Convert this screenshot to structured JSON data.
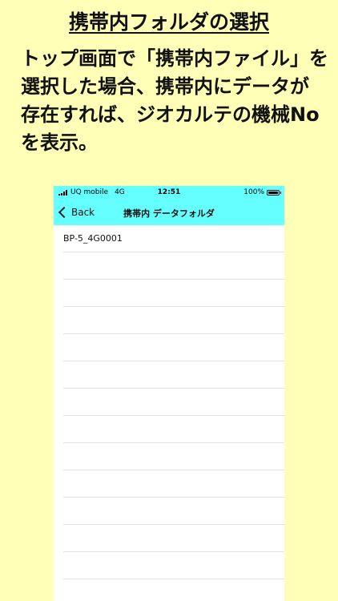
{
  "page": {
    "title": "携帯内フォルダの選択",
    "description_lines": [
      "トップ画面で「携帯内ファイル」を",
      "選択した場合、携帯内にデータが",
      "存在すれば、ジオカルテの機械No",
      "を表示。"
    ]
  },
  "phone": {
    "status": {
      "carrier": "UQ mobile",
      "network": "4G",
      "time": "12:51",
      "battery": "100%"
    },
    "nav": {
      "back_label": "Back",
      "title": "携帯内 データフォルダ"
    },
    "list": {
      "items": [
        "BP-5_4G0001",
        "",
        "",
        "",
        "",
        "",
        "",
        "",
        "",
        "",
        "",
        "",
        ""
      ]
    }
  },
  "colors": {
    "background": "#ffffb8",
    "nav_bar": "#66ffff"
  }
}
